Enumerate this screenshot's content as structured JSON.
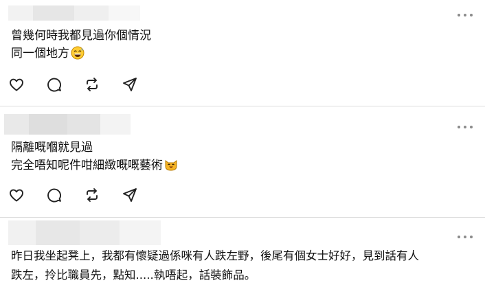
{
  "comments": [
    {
      "lines": [
        "曾幾何時我都見過你個情況",
        "同一個地方"
      ],
      "emoji": "grinning-sweat-emoji"
    },
    {
      "lines": [
        "隔離嘅嗰就見過",
        "完全唔知呢件咁細緻嘅嘅藝術"
      ],
      "emoji": "smiling-cat-emoji"
    },
    {
      "lines": [
        "昨日我坐起凳上，我都有懷疑過係咪有人跌左野，後尾有個女士好好，見到話有人",
        "跌左，拎比職員先，點知.....執唔起，話裝飾品。"
      ]
    }
  ],
  "actions": [
    "heart-icon",
    "comment-icon",
    "repost-icon",
    "share-icon"
  ],
  "colors": {
    "text": "#111111",
    "icon": "#222222",
    "divider": "#dcdcdc",
    "more_dots": "#8a8a8a"
  }
}
